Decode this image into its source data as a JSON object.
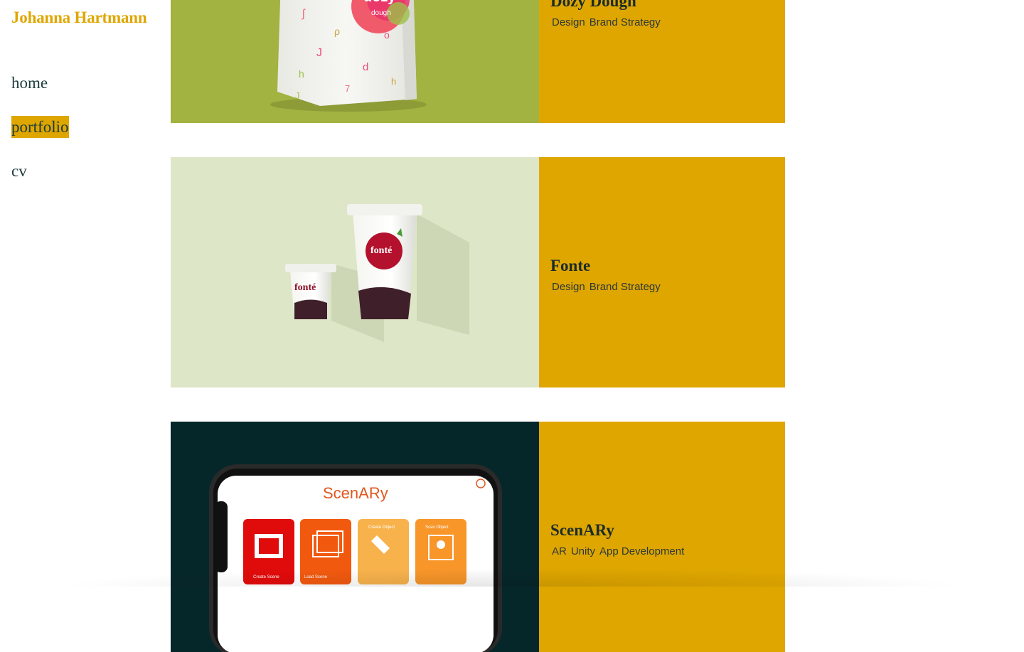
{
  "site": {
    "title": "Johanna Hartmann"
  },
  "nav": {
    "items": [
      {
        "label": "home"
      },
      {
        "label": "portfolio",
        "active": true
      },
      {
        "label": "cv"
      }
    ]
  },
  "projects": [
    {
      "title": "Dozy Dough",
      "tags": [
        "Design",
        "Brand Strategy"
      ],
      "image": {
        "logo_text": "dozy",
        "logo_sub": "dough",
        "background": "#a2b341"
      }
    },
    {
      "title": "Fonte",
      "tags": [
        "Design",
        "Brand Strategy"
      ],
      "image": {
        "logo_text": "fonté",
        "background": "#dde6c6"
      }
    },
    {
      "title": "ScenARy",
      "tags": [
        "AR",
        "Unity",
        "App Development"
      ],
      "image": {
        "app_title": "ScenARy",
        "tiles": [
          "Create Scene",
          "Load Scene",
          "Create Object",
          "Scan Object"
        ],
        "background": "#06272a"
      }
    }
  ],
  "colors": {
    "accent": "#dfa600",
    "text": "#1d3b3b"
  }
}
